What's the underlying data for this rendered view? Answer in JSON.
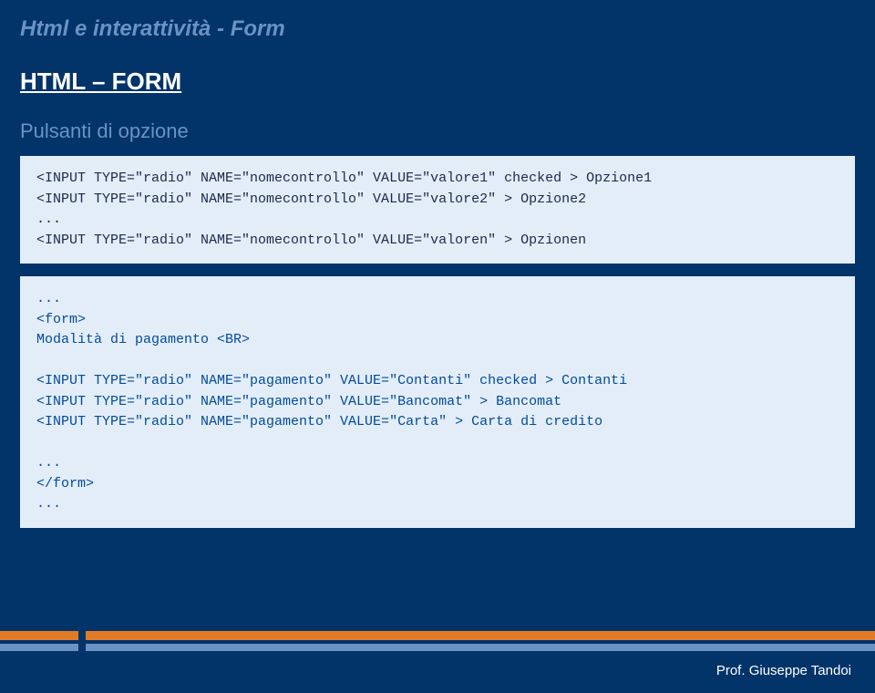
{
  "page_title": "Html e interattività - Form",
  "section_title": "HTML – FORM",
  "subsection_title": "Pulsanti di opzione",
  "code_syntax": "<INPUT TYPE=\"radio\" NAME=\"nomecontrollo\" VALUE=\"valore1\" checked > Opzione1\n<INPUT TYPE=\"radio\" NAME=\"nomecontrollo\" VALUE=\"valore2\" > Opzione2\n...\n<INPUT TYPE=\"radio\" NAME=\"nomecontrollo\" VALUE=\"valoren\" > Opzionen",
  "code_example": "...\n<form>\nModalità di pagamento <BR>\n\n<INPUT TYPE=\"radio\" NAME=\"pagamento\" VALUE=\"Contanti\" checked > Contanti\n<INPUT TYPE=\"radio\" NAME=\"pagamento\" VALUE=\"Bancomat\" > Bancomat\n<INPUT TYPE=\"radio\" NAME=\"pagamento\" VALUE=\"Carta\" > Carta di credito\n\n...\n</form>\n...",
  "footer_credit": "Prof. Giuseppe Tandoi"
}
